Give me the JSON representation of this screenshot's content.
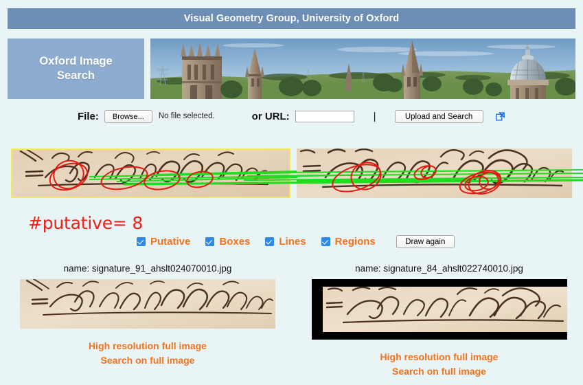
{
  "header": {
    "title": "Visual Geometry Group, University of Oxford",
    "bar_color": "#6e8fb5"
  },
  "logo": {
    "line1": "Oxford Image",
    "line2": "Search",
    "box_color": "#8dacd0"
  },
  "banner": {
    "alt": "oxford-skyline-photo"
  },
  "upload": {
    "file_label": "File:",
    "browse_label": "Browse...",
    "no_file_text": "No file selected.",
    "url_label": "or URL:",
    "url_value": "",
    "url_placeholder": "",
    "separator": "|",
    "submit_label": "Upload and Search",
    "popout_icon": "external-link-icon"
  },
  "matches": {
    "putative_label": "#putative= 8",
    "putative_color": "#f01e14",
    "match_line_color": "#1fdd1f",
    "ellipse_color": "#e21b12",
    "selected_border_color": "#f2e85c"
  },
  "options": {
    "items": [
      {
        "label": "Putative",
        "checked": true
      },
      {
        "label": "Boxes",
        "checked": true
      },
      {
        "label": "Lines",
        "checked": true
      },
      {
        "label": "Regions",
        "checked": true
      }
    ],
    "label_color": "#f3721c",
    "checkbox_color": "#2e8ae6",
    "draw_again_label": "Draw again"
  },
  "results": [
    {
      "name": "name: signature_91_ahslt024070010.jpg",
      "links": [
        "High resolution full image",
        "Search on full image"
      ]
    },
    {
      "name": "name: signature_84_ahslt022740010.jpg",
      "links": [
        "High resolution full image",
        "Search on full image"
      ]
    }
  ],
  "link_color": "#f3721c",
  "page_background": "#e8f4f5"
}
